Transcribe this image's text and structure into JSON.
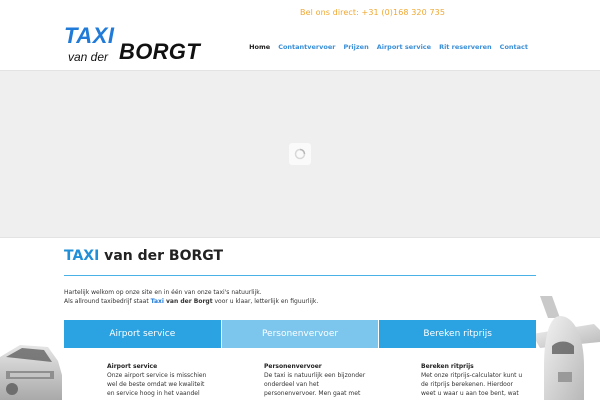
{
  "header": {
    "phone": "Bel ons direct: +31 (0)168 320 735",
    "logo": {
      "taxi": "TAXI",
      "van_der": "van der",
      "borgt": "BORGT"
    }
  },
  "nav": {
    "items": [
      {
        "label": "Home",
        "active": true
      },
      {
        "label": "Contantvervoer",
        "active": false
      },
      {
        "label": "Prijzen",
        "active": false
      },
      {
        "label": "Airport service",
        "active": false
      },
      {
        "label": "Rit reserveren",
        "active": false
      },
      {
        "label": "Contact",
        "active": false
      }
    ]
  },
  "intro": {
    "title_accent": "TAXI",
    "title_rest": " van der BORGT",
    "line1": "Hartelijk welkom op onze site en in één van onze taxi's natuurlijk.",
    "line2_a": "Als allround taxibedrijf staat ",
    "line2_b": "Taxi",
    "line2_c": " van der Borgt",
    "line2_d": " voor u klaar, letterlijk en figuurlijk."
  },
  "tabs": [
    {
      "label": "Airport service",
      "active": false
    },
    {
      "label": "Personenvervoer",
      "active": true
    },
    {
      "label": "Bereken ritprijs",
      "active": false
    }
  ],
  "columns": [
    {
      "title": "Airport service",
      "lines": [
        "Onze airport service is misschien",
        "wel de beste omdat we kwaliteit",
        "en service hoog in het vaandel"
      ]
    },
    {
      "title": "Personenvervoer",
      "lines": [
        "De taxi is natuurlijk een bijzonder",
        "onderdeel van het",
        "personenvervoer. Men gaat met"
      ]
    },
    {
      "title": "Bereken ritprijs",
      "lines": [
        "Met onze ritprijs-calculator kunt u",
        "de ritprijs berekenen. Hierdoor",
        "weet u waar u aan toe bent, wat"
      ]
    }
  ],
  "colors": {
    "accent": "#1f7ad8",
    "tab_blue": "#2ba3e2",
    "tab_active": "#7cc6ee",
    "phone": "#f0a830"
  }
}
